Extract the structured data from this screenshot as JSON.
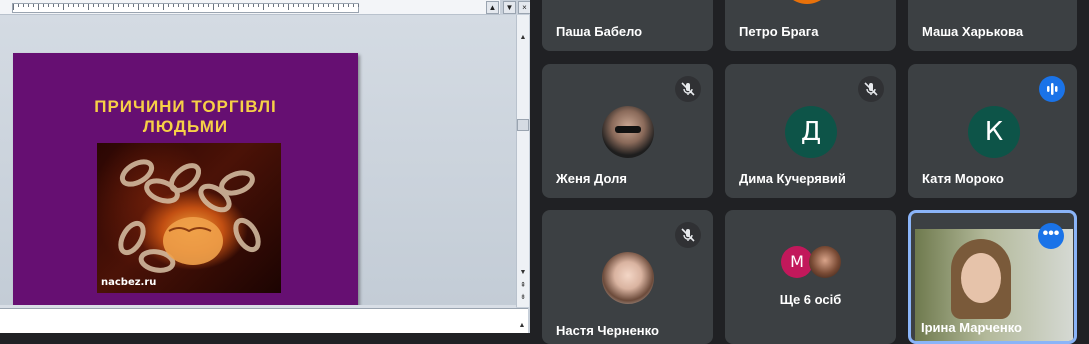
{
  "slide": {
    "title_line1": "ПРИЧИНИ   ТОРГІВЛІ",
    "title_line2": "ЛЮДЬМИ",
    "image_credit": "nacbez.ru"
  },
  "meeting": {
    "participants": [
      {
        "name": "Паша Бабело"
      },
      {
        "name": "Петро Брага"
      },
      {
        "name": "Маша Харькова"
      },
      {
        "name": "Женя Доля",
        "muted": true
      },
      {
        "name": "Дима Кучерявий",
        "initial": "Д",
        "muted": true
      },
      {
        "name": "Катя Мороко",
        "initial": "К",
        "speaking": true
      },
      {
        "name": "Настя Черненко",
        "muted": true
      },
      {
        "name": "Ірина Марченко",
        "active": true
      }
    ],
    "others": {
      "initial": "М",
      "label": "Ще 6 осіб"
    }
  },
  "colors": {
    "slide_bg": "#660f72",
    "slide_title": "#f7d046",
    "tile_bg": "#3c4043",
    "avatar_teal": "#0d5448",
    "avatar_pink": "#c2185b",
    "accent_blue": "#1a73e8"
  }
}
